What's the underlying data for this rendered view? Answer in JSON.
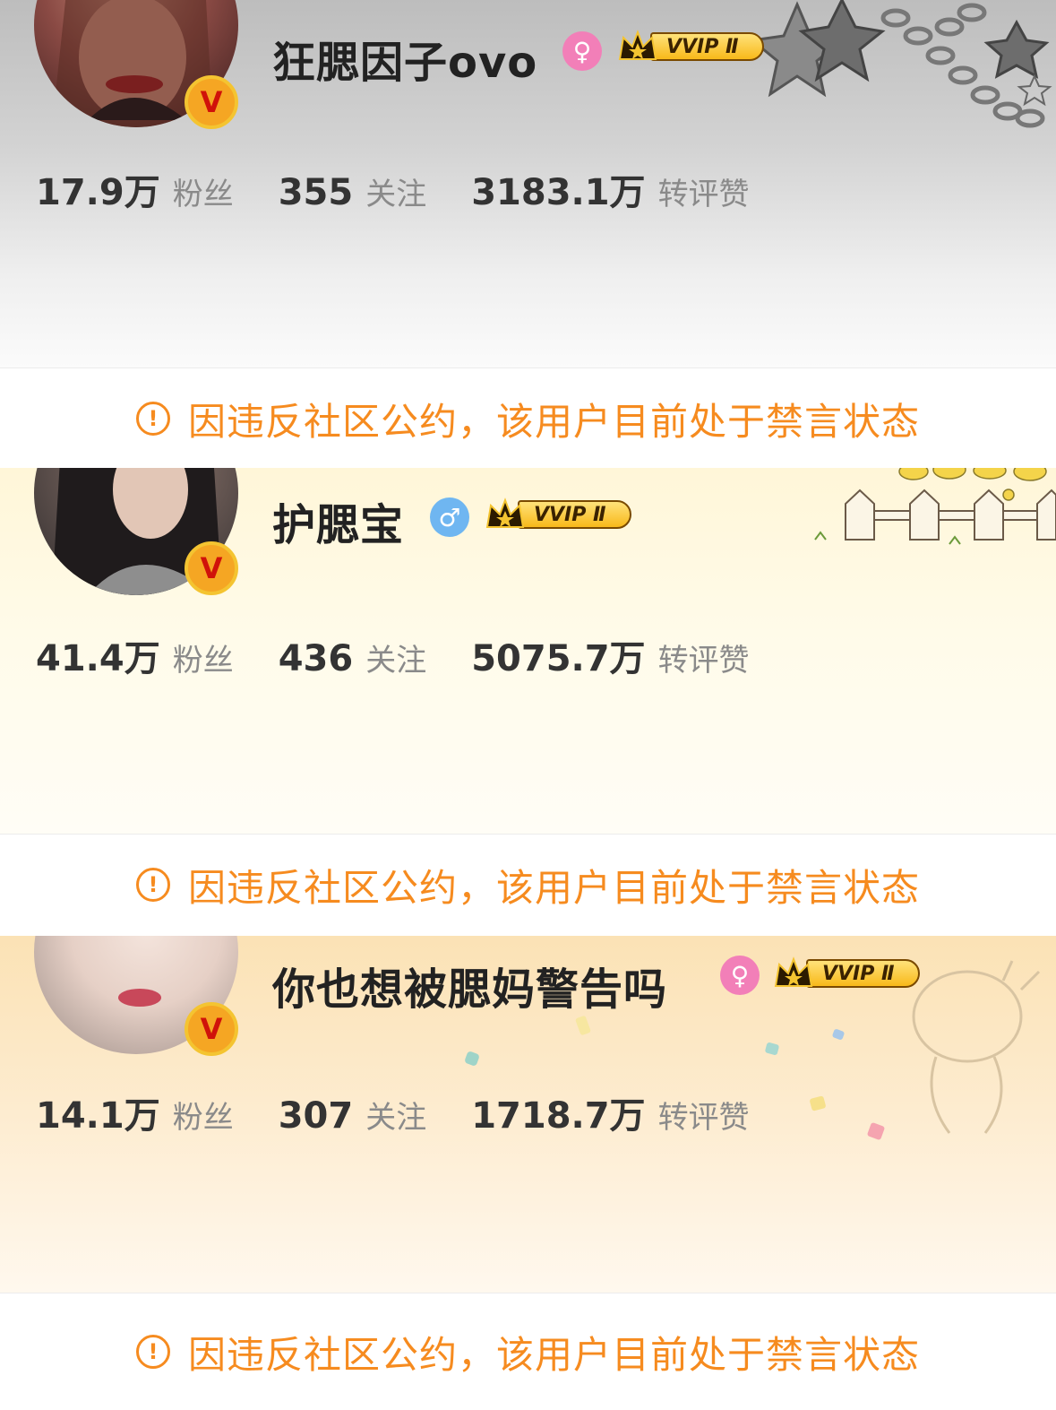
{
  "users": [
    {
      "name": "狂腮因子ovo",
      "gender_icon": "female-icon",
      "gender_symbol": "♀",
      "verified_badge": "V",
      "vip_label": "VVIP Ⅱ",
      "stats": {
        "fans_num": "17.9万",
        "fans_label": "粉丝",
        "follow_num": "355",
        "follow_label": "关注",
        "likes_num": "3183.1万",
        "likes_label": "转评赞"
      },
      "notice": "因违反社区公约，该用户目前处于禁言状态"
    },
    {
      "name": "护腮宝",
      "gender_icon": "male-icon",
      "gender_symbol": "♂",
      "verified_badge": "V",
      "vip_label": "VVIP Ⅱ",
      "stats": {
        "fans_num": "41.4万",
        "fans_label": "粉丝",
        "follow_num": "436",
        "follow_label": "关注",
        "likes_num": "5075.7万",
        "likes_label": "转评赞"
      },
      "notice": "因违反社区公约，该用户目前处于禁言状态"
    },
    {
      "name": "你也想被腮妈警告吗",
      "gender_icon": "female-icon",
      "gender_symbol": "♀",
      "verified_badge": "V",
      "vip_label": "VVIP Ⅱ",
      "stats": {
        "fans_num": "14.1万",
        "fans_label": "粉丝",
        "follow_num": "307",
        "follow_label": "关注",
        "likes_num": "1718.7万",
        "likes_label": "转评赞"
      },
      "notice": "因违反社区公约，该用户目前处于禁言状态"
    }
  ],
  "notice_icon": "!",
  "colors": {
    "notice": "#f68b1f",
    "female": "#f27fb8",
    "male": "#6fb6f1",
    "verified": "#f5a623"
  }
}
